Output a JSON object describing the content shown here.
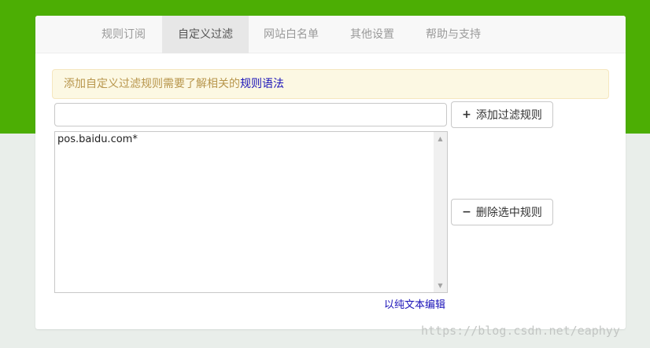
{
  "tabs": [
    {
      "label": "规则订阅",
      "active": false
    },
    {
      "label": "自定义过滤",
      "active": true
    },
    {
      "label": "网站白名单",
      "active": false
    },
    {
      "label": "其他设置",
      "active": false
    },
    {
      "label": "帮助与支持",
      "active": false
    }
  ],
  "notice": {
    "text": "添加自定义过滤规则需要了解相关的",
    "link": "规则语法"
  },
  "rule_input": {
    "value": "",
    "placeholder": ""
  },
  "buttons": {
    "add_label": "添加过滤规则",
    "add_icon": "plus-icon",
    "delete_label": "删除选中规则",
    "delete_icon": "minus-icon"
  },
  "rules": [
    "pos.baidu.com*"
  ],
  "text_edit_link": "以纯文本编辑",
  "watermark": "https://blog.csdn.net/eaphyy",
  "colors": {
    "brand_green": "#4cae04",
    "link_blue": "#1a12b8",
    "notice_text": "#b8964c",
    "notice_bg": "#fcf8e3"
  }
}
